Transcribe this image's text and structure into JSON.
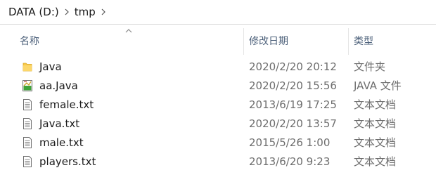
{
  "breadcrumb": {
    "drive": "DATA (D:)",
    "folder": "tmp"
  },
  "columns": {
    "name": "名称",
    "date": "修改日期",
    "type": "类型"
  },
  "files": [
    {
      "name": "Java",
      "date": "2020/2/20 20:12",
      "type": "文件夹",
      "icon": "folder-icon"
    },
    {
      "name": "aa.Java",
      "date": "2020/2/20 15:56",
      "type": "JAVA 文件",
      "icon": "java-file-icon"
    },
    {
      "name": "female.txt",
      "date": "2013/6/19 17:25",
      "type": "文本文档",
      "icon": "text-file-icon"
    },
    {
      "name": "Java.txt",
      "date": "2020/2/20 13:57",
      "type": "文本文档",
      "icon": "text-file-icon"
    },
    {
      "name": "male.txt",
      "date": "2015/5/26 1:00",
      "type": "文本文档",
      "icon": "text-file-icon"
    },
    {
      "name": "players.txt",
      "date": "2013/6/20 9:23",
      "type": "文本文档",
      "icon": "text-file-icon"
    }
  ],
  "colors": {
    "header_text": "#4c607a",
    "folder_yellow": "#f8c84a",
    "java_green": "#3fa33a"
  }
}
